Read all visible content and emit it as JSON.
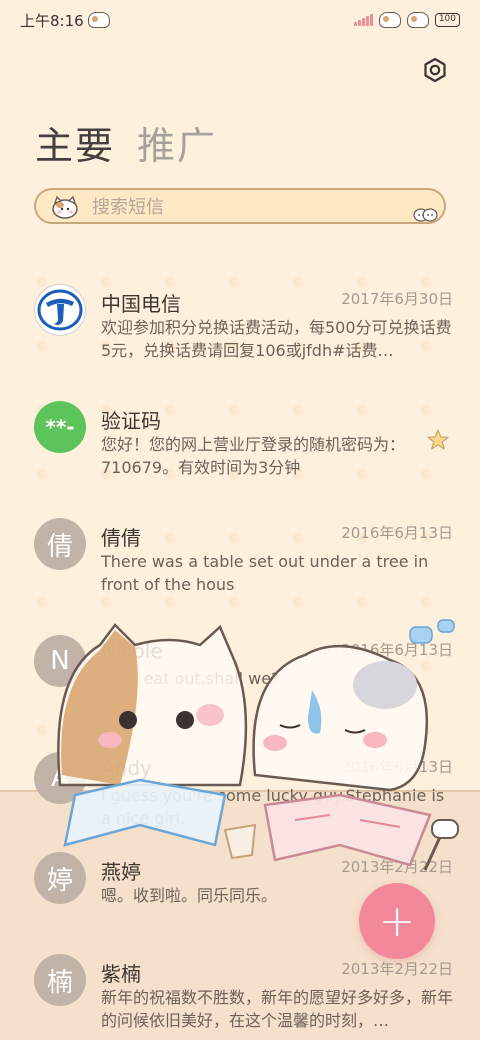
{
  "status_bar": {
    "time": "上午8:16",
    "battery": "100"
  },
  "tabs": [
    {
      "label": "主要",
      "active": true
    },
    {
      "label": "推广",
      "active": false
    }
  ],
  "search": {
    "placeholder": "搜索短信"
  },
  "messages": [
    {
      "sender": "中国电信",
      "date": "2017年6月30日",
      "preview": "欢迎参加积分兑换话费活动，每500分可兑换话费5元，兑换话费请回复106或jfdh#话费…",
      "avatar": "telecom-logo"
    },
    {
      "sender": "验证码",
      "date": "",
      "preview": "您好！您的网上营业厅登录的随机密码为：710679。有效时间为3分钟",
      "avatar": "**-"
    },
    {
      "sender": "倩倩",
      "date": "2016年6月13日",
      "preview": "There was a table set out under a tree in front of the hous",
      "avatar": "倩"
    },
    {
      "sender": "Nicole",
      "date": "2016年6月13日",
      "preview": "Let's eat out,shall we?",
      "avatar": "N"
    },
    {
      "sender": "Andy",
      "date": "2016年6月13日",
      "preview": "I guess you're some lucky guy.Stephanie is a nice girl.",
      "avatar": "A"
    },
    {
      "sender": "燕婷",
      "date": "2013年2月22日",
      "preview": "嗯。收到啦。同乐同乐。",
      "avatar": "婷"
    },
    {
      "sender": "紫楠",
      "date": "2013年2月22日",
      "preview": "新年的祝福数不胜数，新年的愿望好多好多，新年的问候依旧美好，在这个温馨的时刻，…",
      "avatar": "楠"
    }
  ],
  "fab": {
    "label": "+"
  },
  "colors": {
    "background": "#fdf1de",
    "fab": "#f2889a",
    "search_bg": "#fde9c3",
    "verify_avatar": "#5cc45a"
  }
}
